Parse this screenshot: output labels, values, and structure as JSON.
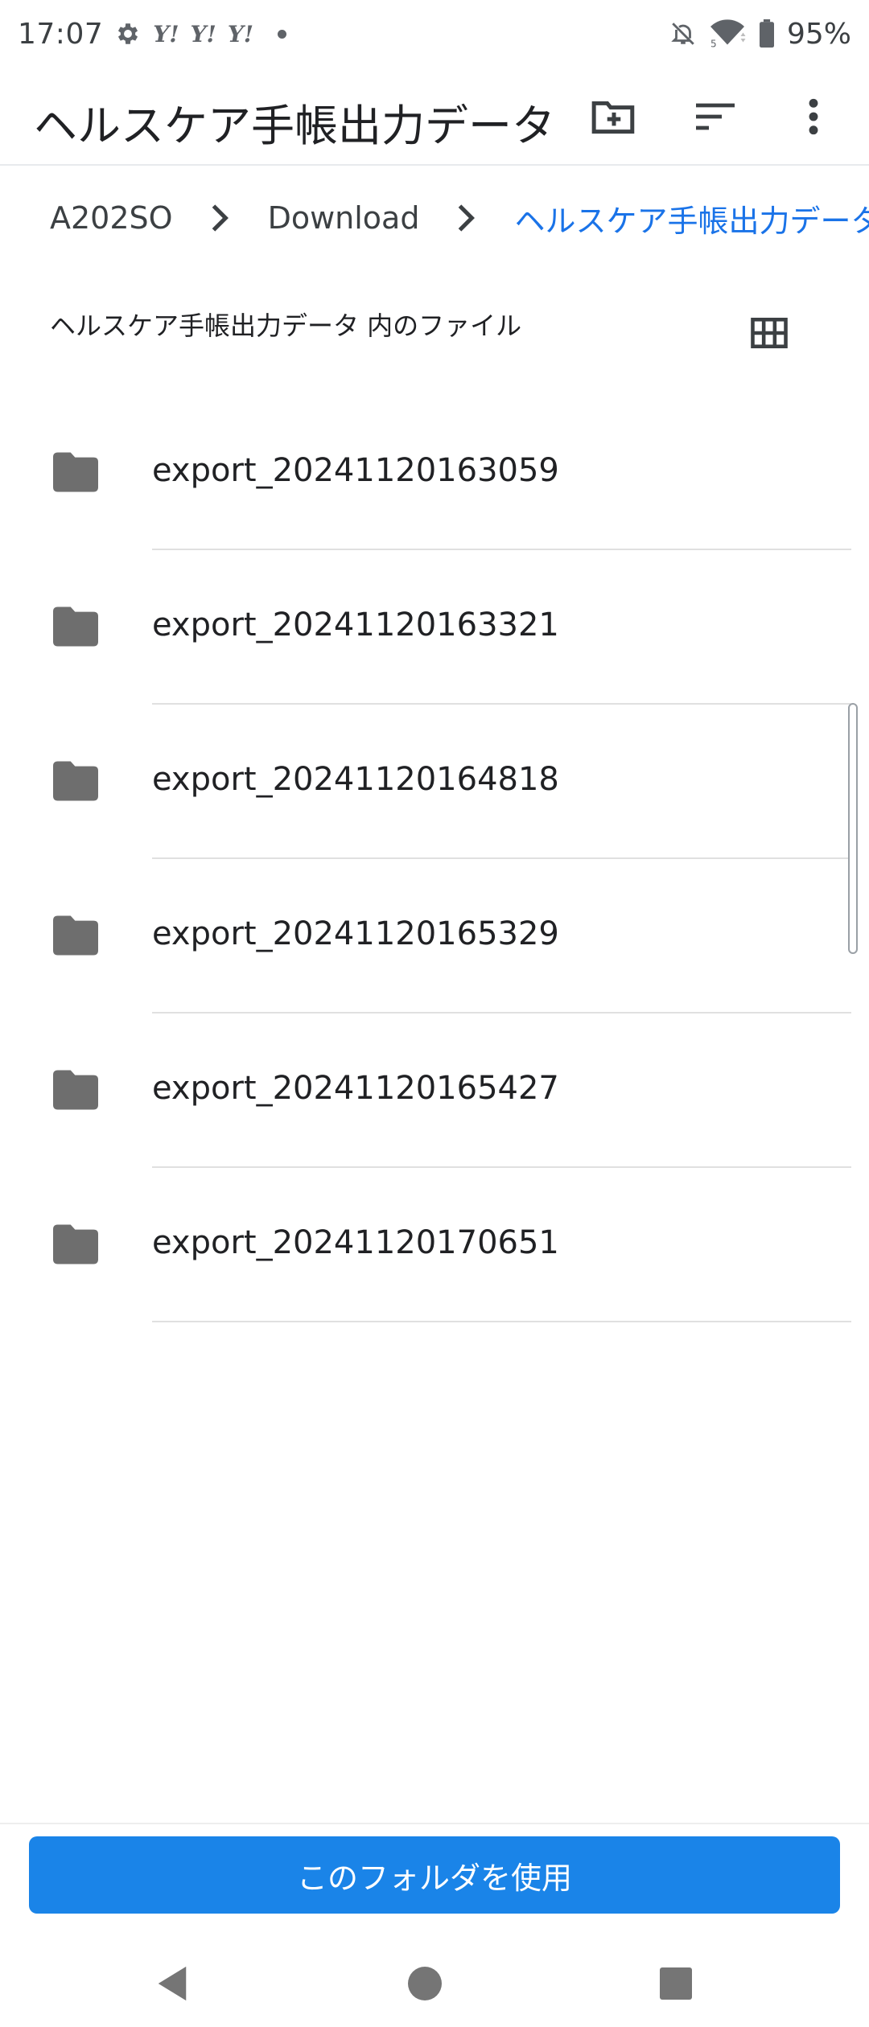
{
  "status_bar": {
    "time": "17:07",
    "notification_icons": [
      "gear-icon",
      "yahoo-icon",
      "yahoo-icon",
      "yahoo-icon",
      "dot-icon"
    ],
    "yahoo_label": "Y!",
    "battery_percent": "95%",
    "system_icons": [
      "notifications-off-icon",
      "wifi-icon",
      "battery-icon"
    ]
  },
  "app_bar": {
    "title": "ヘルスケア手帳出力データ",
    "actions": [
      "create-folder-icon",
      "sort-icon",
      "more-vert-icon"
    ]
  },
  "breadcrumb": {
    "items": [
      "A202SO",
      "Download",
      "ヘルスケア手帳出力データ"
    ]
  },
  "section": {
    "header": "ヘルスケア手帳出力データ 内のファイル",
    "view_toggle_icon": "grid-view-icon"
  },
  "files": [
    {
      "name": "export_20241120163059",
      "icon": "folder-icon"
    },
    {
      "name": "export_20241120163321",
      "icon": "folder-icon"
    },
    {
      "name": "export_20241120164818",
      "icon": "folder-icon"
    },
    {
      "name": "export_20241120165329",
      "icon": "folder-icon"
    },
    {
      "name": "export_20241120165427",
      "icon": "folder-icon"
    },
    {
      "name": "export_20241120170651",
      "icon": "folder-icon"
    }
  ],
  "primary_action": {
    "label": "このフォルダを使用",
    "color": "#1a84e8"
  },
  "nav_bar": {
    "buttons": [
      "back-icon",
      "home-icon",
      "recents-icon"
    ]
  },
  "colors": {
    "accent": "#1a73e8",
    "text_primary": "#202124",
    "folder_icon": "#6e6e6e"
  }
}
